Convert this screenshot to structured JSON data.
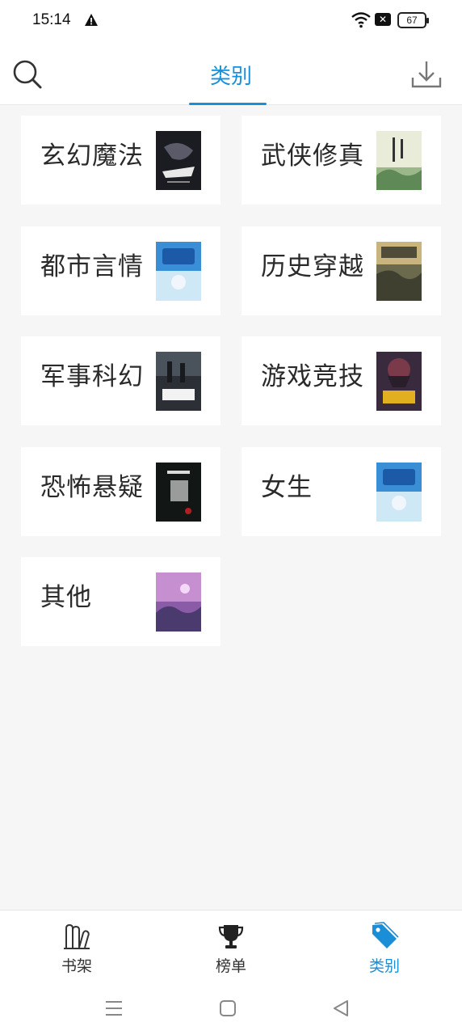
{
  "status": {
    "time": "15:14",
    "battery": "67",
    "notif_icon": "x-box-icon"
  },
  "header": {
    "title": "类别"
  },
  "categories": [
    {
      "label": "玄幻魔法"
    },
    {
      "label": "武侠修真"
    },
    {
      "label": "都市言情"
    },
    {
      "label": "历史穿越"
    },
    {
      "label": "军事科幻"
    },
    {
      "label": "游戏竞技"
    },
    {
      "label": "恐怖悬疑"
    },
    {
      "label": "女生"
    },
    {
      "label": "其他"
    }
  ],
  "tabs": [
    {
      "label": "书架"
    },
    {
      "label": "榜单"
    },
    {
      "label": "类别"
    }
  ],
  "colors": {
    "accent": "#1a8fd8",
    "text": "#2a2a2a",
    "background": "#f6f6f6"
  }
}
